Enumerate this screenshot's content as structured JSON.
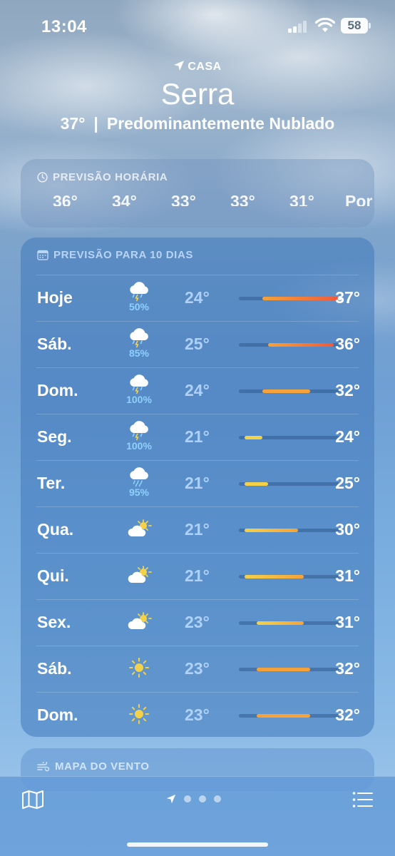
{
  "status_bar": {
    "time": "13:04",
    "battery": "58"
  },
  "header": {
    "location_label": "CASA",
    "city": "Serra",
    "current_temp": "37°",
    "separator": "|",
    "condition": "Predominantemente Nublado"
  },
  "hourly": {
    "title": "PREVISÃO HORÁRIA",
    "temps": [
      "36°",
      "34°",
      "33°",
      "33°",
      "31°",
      "Por"
    ]
  },
  "daily": {
    "title": "PREVISÃO PARA 10 DIAS",
    "days": [
      {
        "name": "Hoje",
        "icon": "thunderstorm-icon",
        "precip": "50%",
        "low": "24°",
        "high": "37°",
        "range": [
          24,
          37
        ],
        "current": 37
      },
      {
        "name": "Sáb.",
        "icon": "thunderstorm-icon",
        "precip": "85%",
        "low": "25°",
        "high": "36°",
        "range": [
          25,
          36
        ]
      },
      {
        "name": "Dom.",
        "icon": "thunderstorm-icon",
        "precip": "100%",
        "low": "24°",
        "high": "32°",
        "range": [
          24,
          32
        ]
      },
      {
        "name": "Seg.",
        "icon": "thunderstorm-icon",
        "precip": "100%",
        "low": "21°",
        "high": "24°",
        "range": [
          21,
          24
        ]
      },
      {
        "name": "Ter.",
        "icon": "rain-icon",
        "precip": "95%",
        "low": "21°",
        "high": "25°",
        "range": [
          21,
          25
        ]
      },
      {
        "name": "Qua.",
        "icon": "partly-cloudy-icon",
        "precip": "",
        "low": "21°",
        "high": "30°",
        "range": [
          21,
          30
        ]
      },
      {
        "name": "Qui.",
        "icon": "partly-cloudy-icon",
        "precip": "",
        "low": "21°",
        "high": "31°",
        "range": [
          21,
          31
        ]
      },
      {
        "name": "Sex.",
        "icon": "partly-cloudy-icon",
        "precip": "",
        "low": "23°",
        "high": "31°",
        "range": [
          23,
          31
        ]
      },
      {
        "name": "Sáb.",
        "icon": "sun-icon",
        "precip": "",
        "low": "23°",
        "high": "32°",
        "range": [
          23,
          32
        ]
      },
      {
        "name": "Dom.",
        "icon": "sun-icon",
        "precip": "",
        "low": "23°",
        "high": "32°",
        "range": [
          23,
          32
        ]
      }
    ],
    "scale_min": 20,
    "scale_max": 37
  },
  "wind_map": {
    "title": "MAPA DO VENTO"
  },
  "colors": {
    "cool": "#f3d24a",
    "warm": "#f5a23a",
    "hot": "#ef5a3c",
    "precip": "#8fd0ff"
  }
}
